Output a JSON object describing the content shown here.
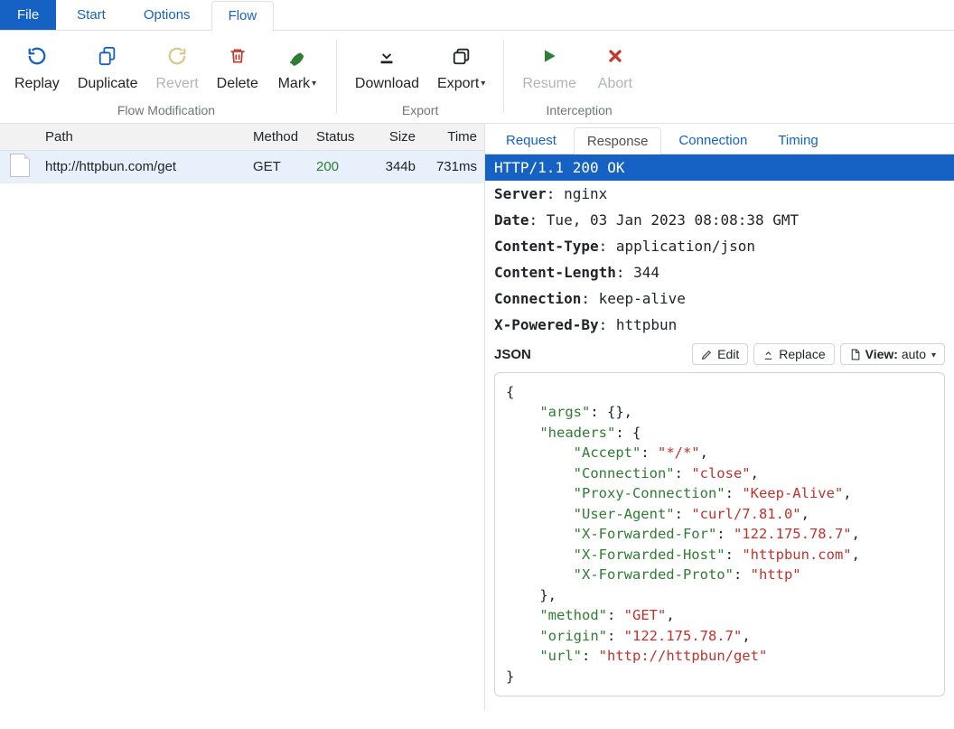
{
  "menubar": {
    "file": "File",
    "items": [
      "Start",
      "Options",
      "Flow"
    ],
    "active": "Flow"
  },
  "toolbar": {
    "groups": [
      {
        "caption": "Flow Modification",
        "items": [
          {
            "id": "replay",
            "label": "Replay"
          },
          {
            "id": "duplicate",
            "label": "Duplicate"
          },
          {
            "id": "revert",
            "label": "Revert",
            "disabled": true
          },
          {
            "id": "delete",
            "label": "Delete"
          },
          {
            "id": "mark",
            "label": "Mark",
            "caret": true
          }
        ]
      },
      {
        "caption": "Export",
        "items": [
          {
            "id": "download",
            "label": "Download"
          },
          {
            "id": "export",
            "label": "Export",
            "caret": true
          }
        ]
      },
      {
        "caption": "Interception",
        "items": [
          {
            "id": "resume",
            "label": "Resume",
            "disabled": true
          },
          {
            "id": "abort",
            "label": "Abort",
            "disabled": true
          }
        ]
      }
    ]
  },
  "flows": {
    "columns": {
      "path": "Path",
      "method": "Method",
      "status": "Status",
      "size": "Size",
      "time": "Time"
    },
    "rows": [
      {
        "path": "http://httpbun.com/get",
        "method": "GET",
        "status": "200",
        "size": "344b",
        "time": "731ms"
      }
    ]
  },
  "detail": {
    "tabs": [
      "Request",
      "Response",
      "Connection",
      "Timing"
    ],
    "active": "Response",
    "response": {
      "status_line": "HTTP/1.1 200 OK",
      "headers": [
        {
          "name": "Server",
          "value": "nginx"
        },
        {
          "name": "Date",
          "value": "Tue, 03 Jan 2023 08:08:38 GMT"
        },
        {
          "name": "Content-Type",
          "value": "application/json"
        },
        {
          "name": "Content-Length",
          "value": "344"
        },
        {
          "name": "Connection",
          "value": "keep-alive"
        },
        {
          "name": "X-Powered-By",
          "value": "httpbun"
        }
      ],
      "content_label": "JSON",
      "buttons": {
        "edit": "Edit",
        "replace": "Replace",
        "view_label": "View:",
        "view_value": "auto"
      },
      "json_tokens": [
        {
          "t": "brace",
          "v": "{",
          "nl": true,
          "ind": 0
        },
        {
          "t": "key",
          "v": "\"args\"",
          "ind": 1
        },
        {
          "t": "punc",
          "v": ": "
        },
        {
          "t": "brace",
          "v": "{}"
        },
        {
          "t": "punc",
          "v": ",",
          "nl": true
        },
        {
          "t": "key",
          "v": "\"headers\"",
          "ind": 1
        },
        {
          "t": "punc",
          "v": ": "
        },
        {
          "t": "brace",
          "v": "{",
          "nl": true
        },
        {
          "t": "key",
          "v": "\"Accept\"",
          "ind": 2
        },
        {
          "t": "punc",
          "v": ": "
        },
        {
          "t": "str",
          "v": "\"*/*\""
        },
        {
          "t": "punc",
          "v": ",",
          "nl": true
        },
        {
          "t": "key",
          "v": "\"Connection\"",
          "ind": 2
        },
        {
          "t": "punc",
          "v": ": "
        },
        {
          "t": "str",
          "v": "\"close\""
        },
        {
          "t": "punc",
          "v": ",",
          "nl": true
        },
        {
          "t": "key",
          "v": "\"Proxy-Connection\"",
          "ind": 2
        },
        {
          "t": "punc",
          "v": ": "
        },
        {
          "t": "str",
          "v": "\"Keep-Alive\""
        },
        {
          "t": "punc",
          "v": ",",
          "nl": true
        },
        {
          "t": "key",
          "v": "\"User-Agent\"",
          "ind": 2
        },
        {
          "t": "punc",
          "v": ": "
        },
        {
          "t": "str",
          "v": "\"curl/7.81.0\""
        },
        {
          "t": "punc",
          "v": ",",
          "nl": true
        },
        {
          "t": "key",
          "v": "\"X-Forwarded-For\"",
          "ind": 2
        },
        {
          "t": "punc",
          "v": ": "
        },
        {
          "t": "str",
          "v": "\"122.175.78.7\""
        },
        {
          "t": "punc",
          "v": ",",
          "nl": true
        },
        {
          "t": "key",
          "v": "\"X-Forwarded-Host\"",
          "ind": 2
        },
        {
          "t": "punc",
          "v": ": "
        },
        {
          "t": "str",
          "v": "\"httpbun.com\""
        },
        {
          "t": "punc",
          "v": ",",
          "nl": true
        },
        {
          "t": "key",
          "v": "\"X-Forwarded-Proto\"",
          "ind": 2
        },
        {
          "t": "punc",
          "v": ": "
        },
        {
          "t": "str",
          "v": "\"http\"",
          "nl": true
        },
        {
          "t": "brace",
          "v": "}",
          "ind": 1
        },
        {
          "t": "punc",
          "v": ",",
          "nl": true
        },
        {
          "t": "key",
          "v": "\"method\"",
          "ind": 1
        },
        {
          "t": "punc",
          "v": ": "
        },
        {
          "t": "str",
          "v": "\"GET\""
        },
        {
          "t": "punc",
          "v": ",",
          "nl": true
        },
        {
          "t": "key",
          "v": "\"origin\"",
          "ind": 1
        },
        {
          "t": "punc",
          "v": ": "
        },
        {
          "t": "str",
          "v": "\"122.175.78.7\""
        },
        {
          "t": "punc",
          "v": ",",
          "nl": true
        },
        {
          "t": "key",
          "v": "\"url\"",
          "ind": 1
        },
        {
          "t": "punc",
          "v": ": "
        },
        {
          "t": "str",
          "v": "\"http://httpbun/get\"",
          "nl": true
        },
        {
          "t": "brace",
          "v": "}",
          "ind": 0
        }
      ]
    }
  }
}
